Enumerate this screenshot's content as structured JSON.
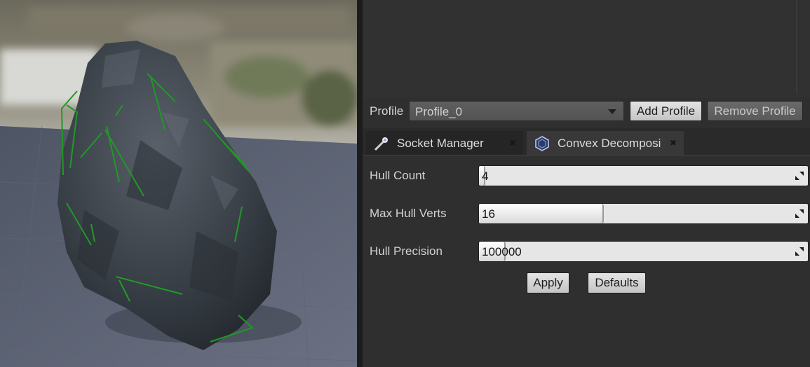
{
  "viewport": {
    "object": "rock mesh with convex collision hull wireframe",
    "colors": {
      "floor": "#5b6170",
      "hull_lines": "#1f9a25",
      "rock": "#3a4046"
    }
  },
  "profile": {
    "label": "Profile",
    "selected": "Profile_0",
    "add_label": "Add Profile",
    "remove_label": "Remove Profile"
  },
  "tabs": [
    {
      "label": "Socket Manager",
      "icon": "socket-wand-icon",
      "active": false
    },
    {
      "label": "Convex Decomposi",
      "icon": "convex-hull-icon",
      "active": true
    }
  ],
  "properties": [
    {
      "label": "Hull Count",
      "value": "4",
      "fill": 0.02
    },
    {
      "label": "Max Hull Verts",
      "value": "16",
      "fill": 0.38
    },
    {
      "label": "Hull Precision",
      "value": "100000",
      "fill": 0.08
    }
  ],
  "actions": {
    "apply_label": "Apply",
    "defaults_label": "Defaults"
  },
  "colors": {
    "panel_bg": "#2f2f2f",
    "button_bg": "#d4d4d4",
    "field_bg": "#e6e6e6"
  }
}
